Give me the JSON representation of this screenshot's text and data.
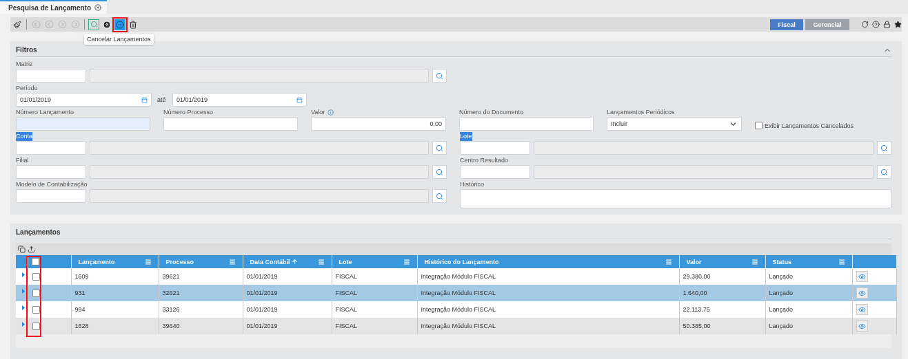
{
  "tab": {
    "label": "Pesquisa de Lançamento"
  },
  "toolbar": {
    "buttons": [
      {
        "kind": "clear",
        "disabled": false,
        "focused": false,
        "pressed": false,
        "annotated": false
      },
      {
        "kind": "separator"
      },
      {
        "kind": "first",
        "disabled": true,
        "focused": false,
        "pressed": false,
        "annotated": false
      },
      {
        "kind": "prev",
        "disabled": true,
        "focused": false,
        "pressed": false,
        "annotated": false
      },
      {
        "kind": "next",
        "disabled": true,
        "focused": false,
        "pressed": false,
        "annotated": false
      },
      {
        "kind": "last",
        "disabled": true,
        "focused": false,
        "pressed": false,
        "annotated": false
      },
      {
        "kind": "separator"
      },
      {
        "kind": "search",
        "disabled": false,
        "focused": true,
        "pressed": false,
        "annotated": false
      },
      {
        "kind": "upload",
        "disabled": false,
        "focused": false,
        "pressed": false,
        "annotated": false
      },
      {
        "kind": "cancel",
        "disabled": false,
        "focused": false,
        "pressed": true,
        "annotated": true,
        "tooltip": "Cancelar Lançamentos"
      },
      {
        "kind": "delete",
        "disabled": false,
        "focused": false,
        "pressed": false,
        "annotated": false
      }
    ],
    "modes": [
      {
        "label": "Fiscal",
        "selected": true
      },
      {
        "label": "Gerencial",
        "selected": false
      }
    ]
  },
  "filters": {
    "title": "Filtros",
    "expanded": true,
    "matriz": {
      "label": "Matriz"
    },
    "periodo": {
      "label": "Período",
      "from": "01/01/2019",
      "separator": "até",
      "to": "01/01/2019"
    },
    "numero_lancamento": {
      "label": "Número Lançamento",
      "focused": true
    },
    "numero_processo": {
      "label": "Número Processo"
    },
    "valor": {
      "label": "Valor",
      "value": "0,00"
    },
    "numero_documento": {
      "label": "Número do Documento"
    },
    "lancamentos_periodicos": {
      "label": "Lançamentos Periódicos",
      "value": "Incluir"
    },
    "exibir_cancelados": {
      "label": "Exibir Lançamentos Cancelados",
      "checked": false
    },
    "lookups_left": [
      {
        "label": "Conta",
        "highlighted": true
      },
      {
        "label": "Filial",
        "highlighted": false
      },
      {
        "label": "Modelo de Contabilização",
        "highlighted": false
      }
    ],
    "lookups_right": [
      {
        "label": "Lote",
        "highlighted": true
      },
      {
        "label": "Centro Resultado",
        "highlighted": false
      }
    ],
    "historico": {
      "label": "Histórico"
    }
  },
  "lancamentos": {
    "title": "Lançamentos",
    "header_checked": false,
    "checkbox_column_annotated": true,
    "columns": [
      {
        "label": "Lançamento",
        "sorted": false
      },
      {
        "label": "Processo",
        "sorted": false
      },
      {
        "label": "Data Contábil",
        "sorted": true
      },
      {
        "label": "Lote",
        "sorted": false
      },
      {
        "label": "Histórico do Lançamento",
        "sorted": false
      },
      {
        "label": "Valor",
        "sorted": false
      },
      {
        "label": "Status",
        "sorted": false
      }
    ],
    "rows": [
      {
        "cells": [
          "1609",
          "39621",
          "01/01/2019",
          "FISCAL",
          "Integração Módulo FISCAL",
          "29.380,00",
          "Lançado"
        ],
        "selected": false,
        "checked": false
      },
      {
        "cells": [
          "931",
          "32621",
          "01/01/2019",
          "FISCAL",
          "Integração Módulo FISCAL",
          "1.640,00",
          "Lançado"
        ],
        "selected": true,
        "checked": false
      },
      {
        "cells": [
          "994",
          "33126",
          "01/01/2019",
          "FISCAL",
          "Integração Módulo FISCAL",
          "22.113,75",
          "Lançado"
        ],
        "selected": false,
        "checked": false
      },
      {
        "cells": [
          "1628",
          "39640",
          "01/01/2019",
          "FISCAL",
          "Integração Módulo FISCAL",
          "50.385,00",
          "Lançado"
        ],
        "selected": false,
        "checked": false
      }
    ]
  }
}
